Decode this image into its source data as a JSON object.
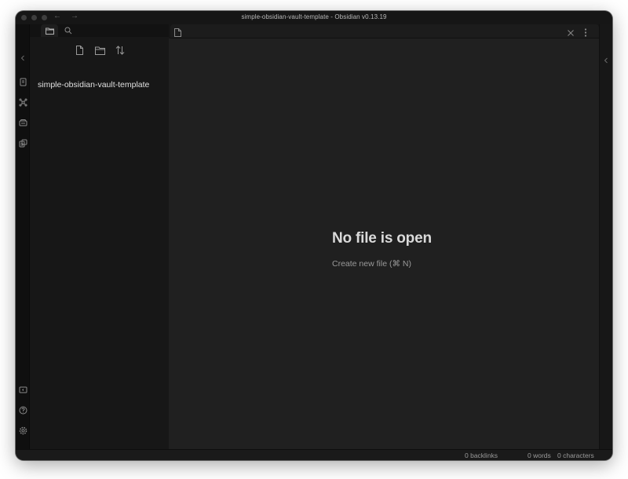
{
  "window": {
    "title": "simple-obsidian-vault-template - Obsidian v0.13.19",
    "back_arrow": "←",
    "forward_arrow": "→"
  },
  "ribbon": {
    "icons": [
      "quick-switcher-icon",
      "graph-view-icon",
      "open-canvas-icon",
      "command-palette-icon",
      "open-vault-icon",
      "help-icon",
      "settings-icon"
    ]
  },
  "sidebar": {
    "tabs": [
      "file-explorer-icon",
      "search-icon"
    ],
    "actions": [
      "new-note-icon",
      "new-folder-icon",
      "sort-icon"
    ],
    "vault_name": "simple-obsidian-vault-template"
  },
  "main": {
    "empty_title": "No file is open",
    "create_new_file": "Create new file (⌘ N)"
  },
  "statusbar": {
    "backlinks": "0 backlinks",
    "words": "0 words",
    "characters": "0 characters"
  },
  "colors": {
    "background": "#1e1e1e",
    "sidebar": "#171717",
    "ribbon": "#0f0f0f",
    "text": "#dadada",
    "muted_text": "#9a9a9a"
  }
}
